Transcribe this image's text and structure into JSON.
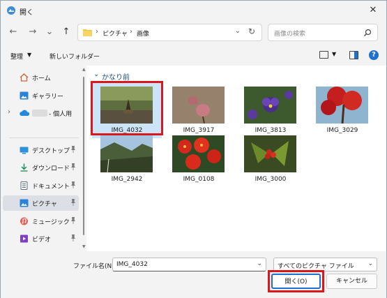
{
  "window": {
    "title": "開く",
    "close_glyph": "✕"
  },
  "nav": {
    "back_glyph": "←",
    "forward_glyph": "→",
    "recent_glyph": "⌄",
    "up_glyph": "↑",
    "breadcrumb": [
      "ピクチャ",
      "画像"
    ],
    "separator": "›",
    "dropdown_glyph": "⌄",
    "refresh_glyph": "↻",
    "search_placeholder": "画像の検索"
  },
  "toolbar": {
    "organize_label": "整理",
    "organize_arrow": "▼",
    "new_folder_label": "新しいフォルダー",
    "view_dd": "▼",
    "help_glyph": "?"
  },
  "sidebar": {
    "items": [
      {
        "label": "ホーム",
        "icon": "home-icon",
        "pinned": false
      },
      {
        "label": "ギャラリー",
        "icon": "gallery-icon",
        "pinned": false
      },
      {
        "label": "- 個人用",
        "icon": "cloud-icon",
        "pinned": false,
        "expandable": true
      },
      {
        "label": "デスクトップ",
        "icon": "desktop-icon",
        "pinned": true
      },
      {
        "label": "ダウンロード",
        "icon": "download-icon",
        "pinned": true
      },
      {
        "label": "ドキュメント",
        "icon": "document-icon",
        "pinned": true
      },
      {
        "label": "ピクチャ",
        "icon": "pictures-icon",
        "pinned": true,
        "selected": true
      },
      {
        "label": "ミュージック",
        "icon": "music-icon",
        "pinned": true
      },
      {
        "label": "ビデオ",
        "icon": "video-icon",
        "pinned": true
      }
    ],
    "chevron_glyph": "›",
    "pin_glyph": "📌",
    "scroll_up": "▲",
    "scroll_down": "▼"
  },
  "content": {
    "group_label": "かなり前",
    "group_chevron": "⌄",
    "files": [
      {
        "name": "IMG_4032",
        "selected": true
      },
      {
        "name": "IMG_3917"
      },
      {
        "name": "IMG_3813"
      },
      {
        "name": "IMG_3029"
      },
      {
        "name": "IMG_2942"
      },
      {
        "name": "IMG_0108"
      },
      {
        "name": "IMG_3000"
      }
    ]
  },
  "footer": {
    "filename_label": "ファイル名(N):",
    "filename_value": "IMG_4032",
    "filetype_value": "すべてのピクチャ ファイル",
    "dropdown_glyph": "⌄",
    "open_label": "開く(O)",
    "cancel_label": "キャンセル"
  },
  "colors": {
    "accent": "#1f6fce",
    "highlight_frame": "#d8171e",
    "selection": "#cce4f7"
  }
}
